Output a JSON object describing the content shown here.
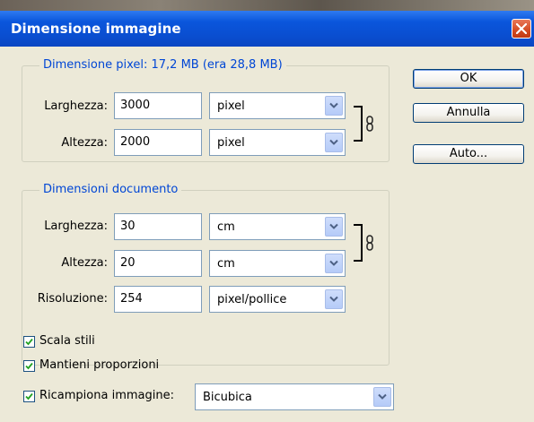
{
  "window": {
    "title": "Dimensione immagine"
  },
  "pixel_dimensions": {
    "legend": "Dimensione pixel: 17,2 MB (era 28,8 MB)",
    "width_label": "Larghezza:",
    "width_value": "3000",
    "width_unit": "pixel",
    "height_label": "Altezza:",
    "height_value": "2000",
    "height_unit": "pixel"
  },
  "document_size": {
    "legend": "Dimensioni documento",
    "width_label": "Larghezza:",
    "width_value": "30",
    "width_unit": "cm",
    "height_label": "Altezza:",
    "height_value": "20",
    "height_unit": "cm",
    "resolution_label": "Risoluzione:",
    "resolution_value": "254",
    "resolution_unit": "pixel/pollice"
  },
  "buttons": {
    "ok": "OK",
    "cancel": "Annulla",
    "auto": "Auto..."
  },
  "options": {
    "scale_styles": {
      "label": "Scala stili",
      "checked": true
    },
    "constrain": {
      "label": "Mantieni proporzioni",
      "checked": true
    },
    "resample": {
      "label": "Ricampiona immagine:",
      "checked": true,
      "method": "Bicubica"
    }
  },
  "colors": {
    "title_bar": "#0a56dc",
    "legend_text": "#0046d5",
    "close_button": "#d44a22"
  },
  "icons": [
    "close-icon",
    "dropdown-arrow-icon",
    "chain-link-icon",
    "checkmark-icon"
  ]
}
